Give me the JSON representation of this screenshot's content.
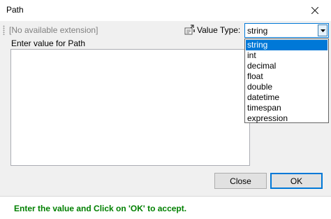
{
  "window": {
    "title": "Path"
  },
  "toolbar": {
    "extension_label": "[No available extension]",
    "value_type_label": "Value Type:",
    "value_type_selected": "string"
  },
  "editor": {
    "label": "Enter value for Path",
    "value": ""
  },
  "dropdown": {
    "options": [
      "string",
      "int",
      "decimal",
      "float",
      "double",
      "datetime",
      "timespan",
      "expression"
    ],
    "selected_index": 0
  },
  "buttons": {
    "close_label": "Close",
    "ok_label": "OK"
  },
  "status": {
    "message": "Enter the value and Click on 'OK' to accept.",
    "color": "#008000"
  },
  "colors": {
    "accent": "#0078d7"
  }
}
